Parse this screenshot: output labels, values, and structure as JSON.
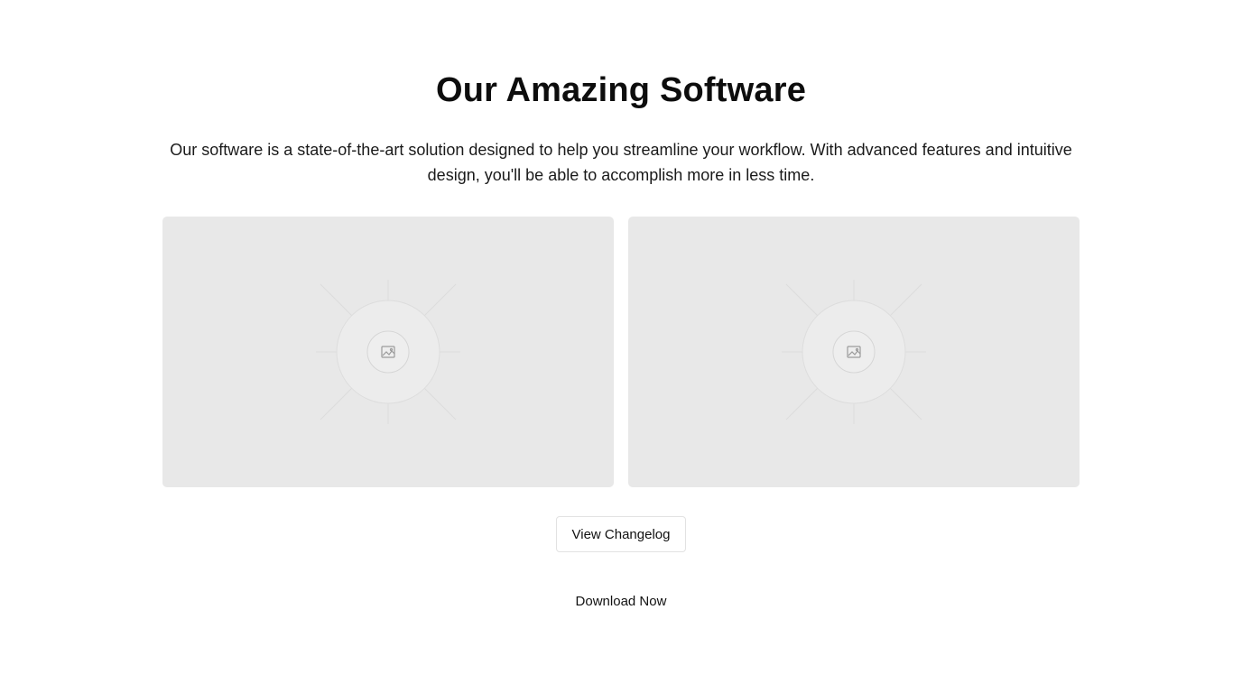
{
  "hero": {
    "title": "Our Amazing Software",
    "description": "Our software is a state-of-the-art solution designed to help you streamline your workflow. With advanced features and intuitive design, you'll be able to accomplish more in less time."
  },
  "gallery": {
    "images": [
      {
        "icon": "image-placeholder-icon"
      },
      {
        "icon": "image-placeholder-icon"
      }
    ]
  },
  "actions": {
    "changelog_label": "View Changelog",
    "download_label": "Download Now"
  },
  "colors": {
    "background": "#ffffff",
    "text": "#111111",
    "placeholder_bg": "#e8e8e8",
    "button_border": "#e2e2e2"
  }
}
